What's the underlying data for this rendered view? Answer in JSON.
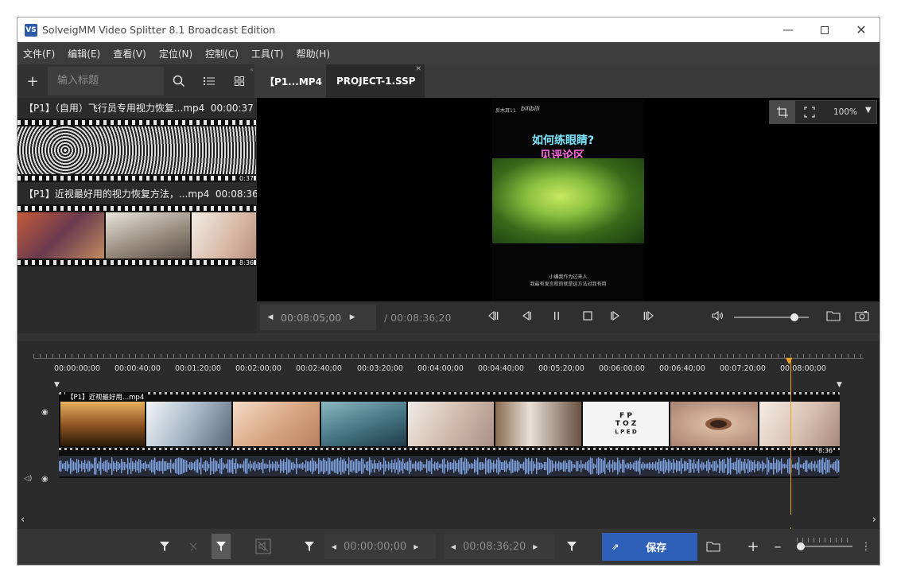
{
  "window": {
    "title": "SolveigMM Video Splitter 8.1 Broadcast Edition",
    "icon_text": "VS",
    "controls": [
      "minimize-icon",
      "maximize-icon",
      "close-icon"
    ]
  },
  "menu": [
    "文件(F)",
    "编辑(E)",
    "查看(V)",
    "定位(N)",
    "控制(C)",
    "工具(T)",
    "帮助(H)"
  ],
  "library": {
    "search_placeholder": "输入标题",
    "items": [
      {
        "title": "【P1】（自用）飞行员专用视力恢复...mp4",
        "duration": "00:00:37",
        "badge": "0:37"
      },
      {
        "title": "【P1】近视最好用的视力恢复方法，...mp4",
        "duration": "00:08:36",
        "badge": "8:36"
      }
    ]
  },
  "tabs": [
    {
      "label": "【P1...MP4",
      "active": false
    },
    {
      "label": "PROJECT-1.SSP",
      "active": true
    }
  ],
  "player": {
    "zoom": "100%",
    "overlay_small": "反木耳11",
    "overlay_logo": "bilibili",
    "caption_line1": "如何练眼睛?",
    "caption_line2": "见评论区",
    "subtitle_line1": "小编我作为过来人",
    "subtitle_line2": "我最有发言权的就是这方法对我有用",
    "current_time": "00:08:05;00",
    "total_time": "/ 00:08:36;20"
  },
  "timeline": {
    "ruler_labels": [
      "00:00:00;00",
      "00:00:40;00",
      "00:01:20;00",
      "00:02:00;00",
      "00:02:40;00",
      "00:03:20;00",
      "00:04:00;00",
      "00:04:40;00",
      "00:05:20;00",
      "00:06:00;00",
      "00:06:40;00",
      "00:07:20;00",
      "00:08:00;00"
    ],
    "clip_title": "【P1】近视最好用...mp4",
    "clip_badge": "8:36"
  },
  "bottom": {
    "start_time": "00:00:00;00",
    "end_time": "00:08:36;20",
    "save_label": "保存"
  },
  "colors": {
    "accent": "#2e5fb9",
    "playhead": "#f0a020",
    "waveform": "#7fa2e0"
  }
}
